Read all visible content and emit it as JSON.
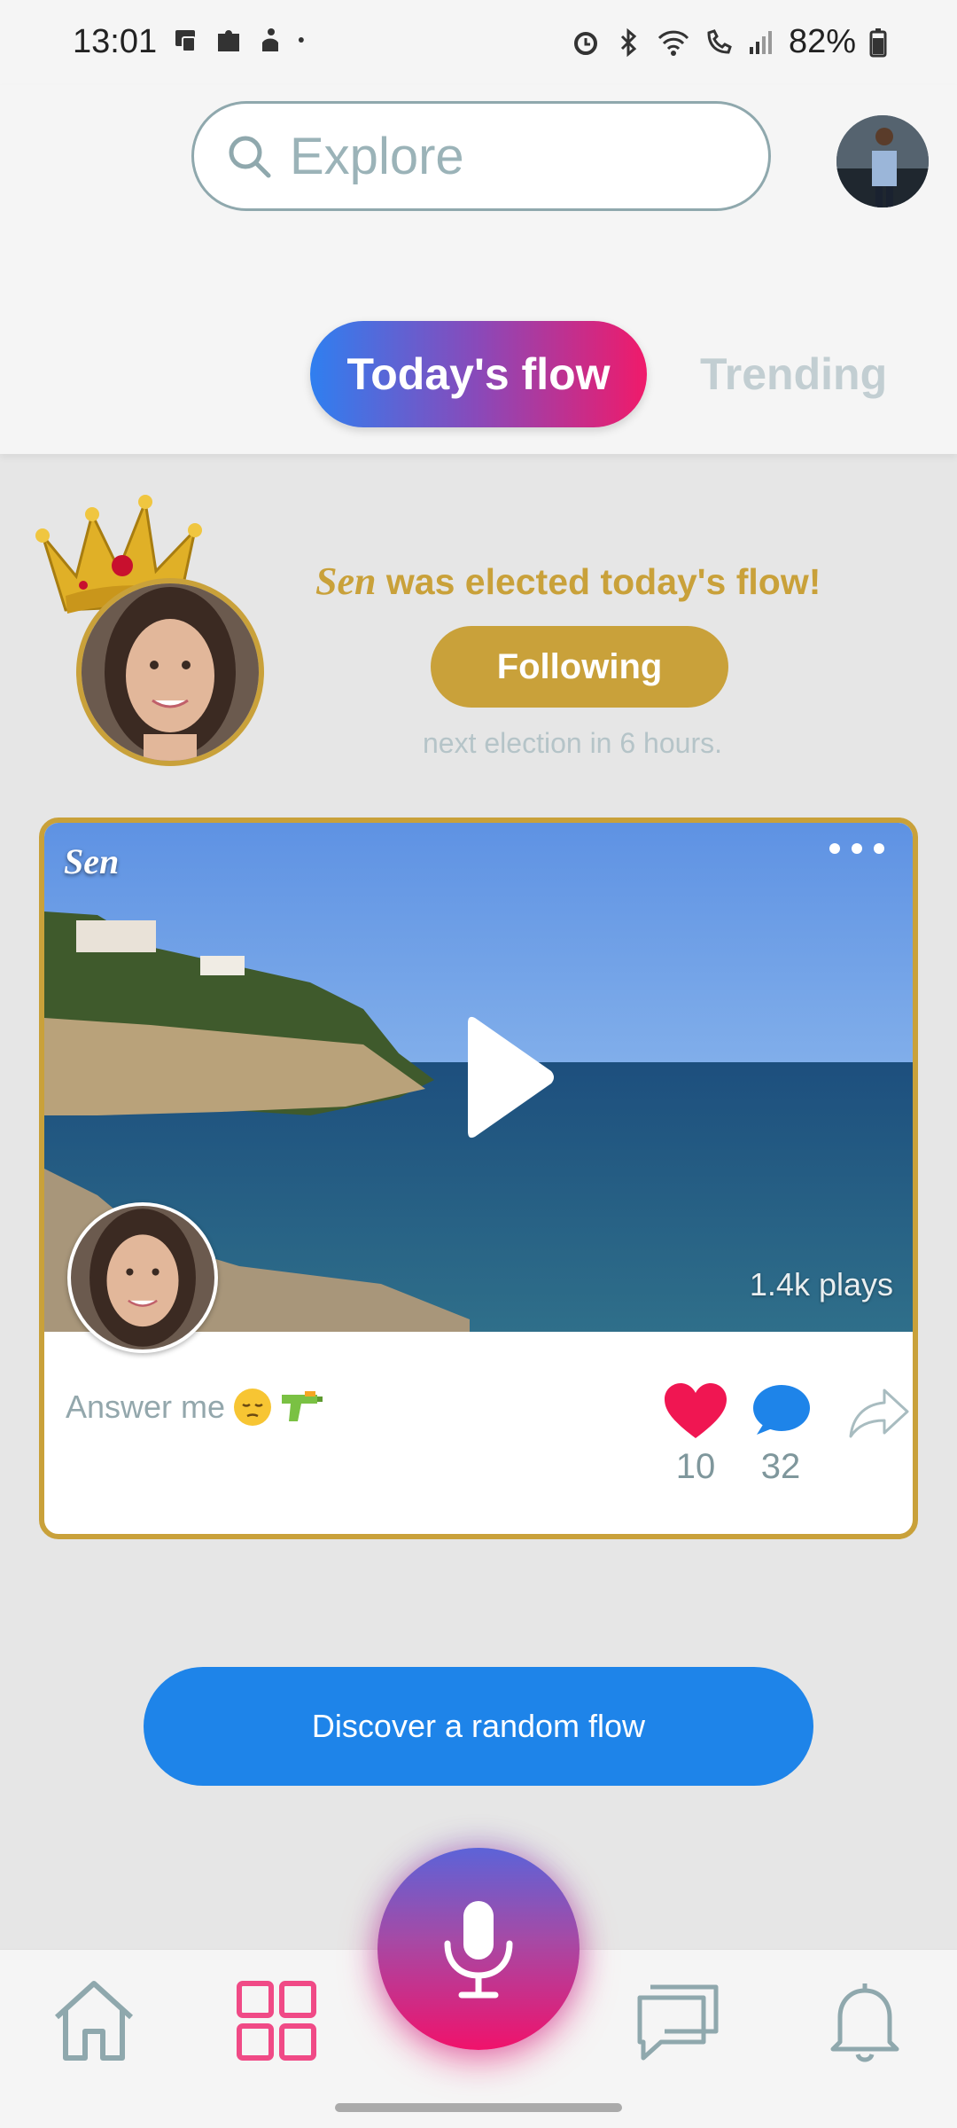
{
  "status_bar": {
    "time": "13:01",
    "battery": "82%",
    "icons": [
      "notification-icon",
      "puzzle-icon",
      "hand-icon",
      "dot-icon",
      "alarm-icon",
      "bluetooth-icon",
      "wifi-icon",
      "call-icon",
      "signal-icon",
      "battery-icon"
    ]
  },
  "header": {
    "search_placeholder": "Explore",
    "tabs": [
      {
        "label": "Today's flow",
        "active": true
      },
      {
        "label": "Trending",
        "active": false
      }
    ]
  },
  "winner": {
    "name": "Sen",
    "message": " was elected today's flow!",
    "follow_label": "Following",
    "next_election": "next election in 6 hours."
  },
  "post": {
    "author": "Sen",
    "plays": "1.4k plays",
    "caption": "Answer me",
    "caption_emojis": [
      "pensive-face-emoji",
      "water-pistol-emoji"
    ],
    "likes": "10",
    "comments": "32"
  },
  "discover_label": "Discover a random flow",
  "colors": {
    "gold": "#c9a13a",
    "blue": "#1e84e9",
    "pink": "#f01a6a",
    "like_red": "#f01652"
  },
  "nav": [
    "home-icon",
    "grid-icon",
    "mic-icon",
    "chat-icon",
    "bell-icon"
  ]
}
